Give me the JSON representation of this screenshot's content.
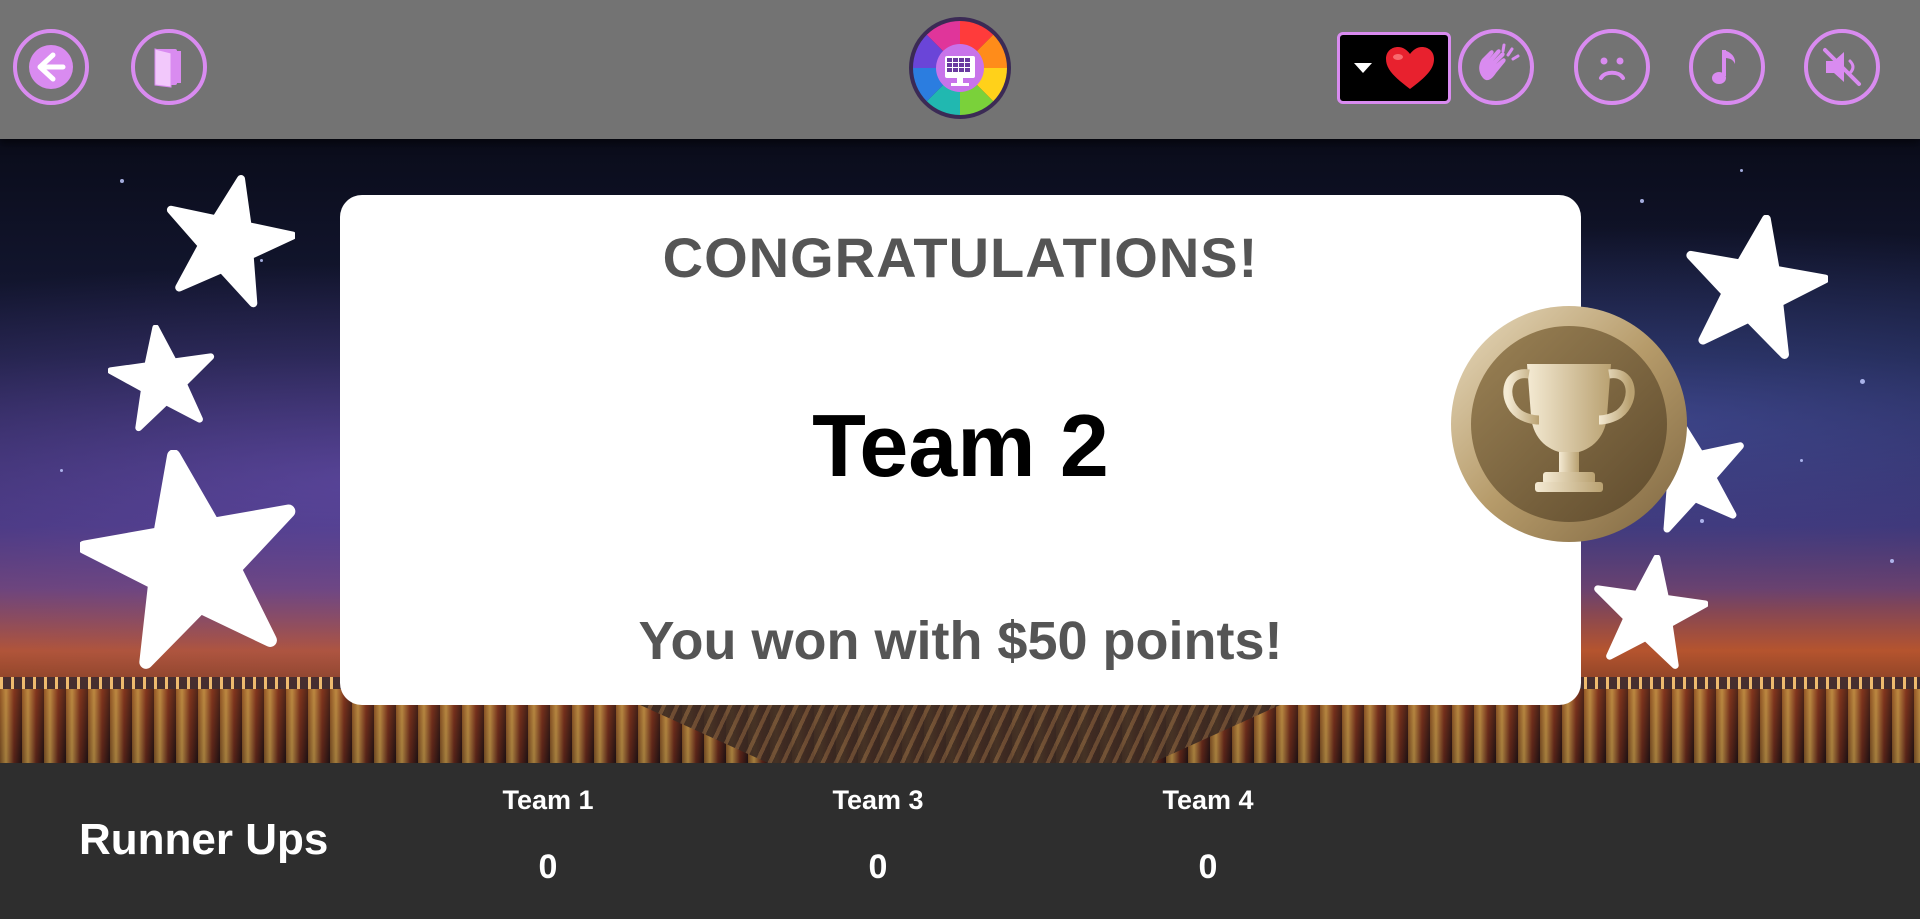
{
  "toolbar": {
    "back_icon": "arrow-left-icon",
    "exit_icon": "door-exit-icon",
    "logo_icon": "color-wheel-board-icon",
    "reaction_selected": "heart",
    "applause_icon": "clapping-hands-icon",
    "sad_icon": "sad-face-icon",
    "music_icon": "music-note-icon",
    "mute_icon": "speaker-muted-icon",
    "accent_color": "#d98bf0",
    "bar_color": "#737373"
  },
  "card": {
    "heading": "CONGRATULATIONS!",
    "winner": "Team 2",
    "message": "You won with $50 points!"
  },
  "medal_icon": "trophy-medal-icon",
  "runner_ups": {
    "title": "Runner Ups",
    "teams": [
      {
        "name": "Team 1",
        "score": "0"
      },
      {
        "name": "Team 3",
        "score": "0"
      },
      {
        "name": "Team 4",
        "score": "0"
      }
    ]
  }
}
